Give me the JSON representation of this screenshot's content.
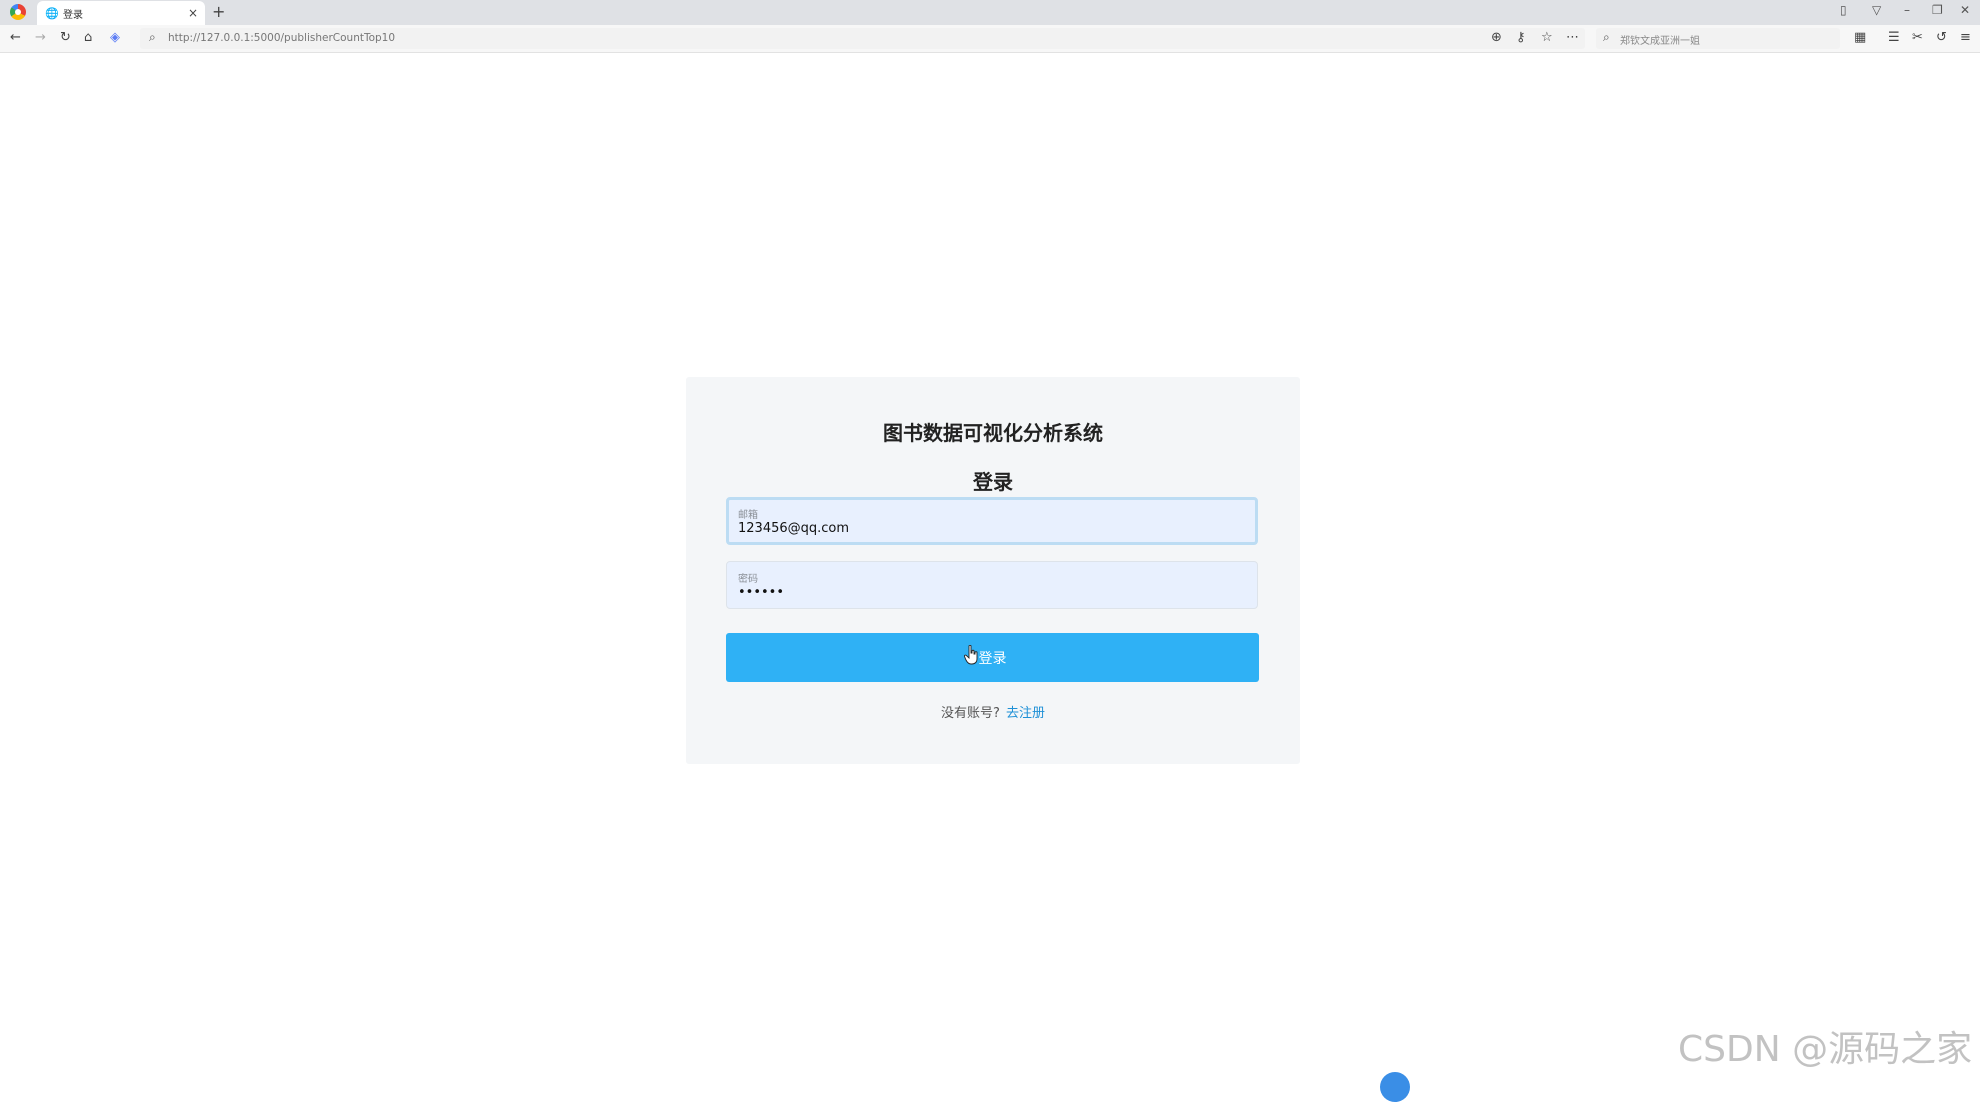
{
  "browser": {
    "tab_title": "登录",
    "tab_close": "×",
    "new_tab": "+",
    "url": "http://127.0.0.1:5000/publisherCountTop10",
    "search_placeholder": "郑钦文成亚洲一姐"
  },
  "login": {
    "system_title": "图书数据可视化分析系统",
    "heading": "登录",
    "email_label": "邮箱",
    "email_value": "123456@qq.com",
    "password_label": "密码",
    "password_value": "••••••",
    "submit_label": "登录",
    "no_account_text": "没有账号?",
    "register_link": "去注册"
  },
  "colors": {
    "button": "#2fb1f5",
    "link": "#1e90d6",
    "card_bg": "#f4f6f8",
    "input_bg": "#e8f0fe"
  },
  "watermark": "CSDN @源码之家",
  "icons": [
    "browser-logo-icon",
    "globe-icon",
    "back-icon",
    "forward-icon",
    "refresh-icon",
    "home-icon",
    "extension-icon",
    "search-icon",
    "zoom-icon",
    "key-icon",
    "star-icon",
    "more-icon",
    "apps-icon",
    "favorites-icon",
    "scissors-icon",
    "undo-icon",
    "menu-icon",
    "cursor-icon"
  ]
}
